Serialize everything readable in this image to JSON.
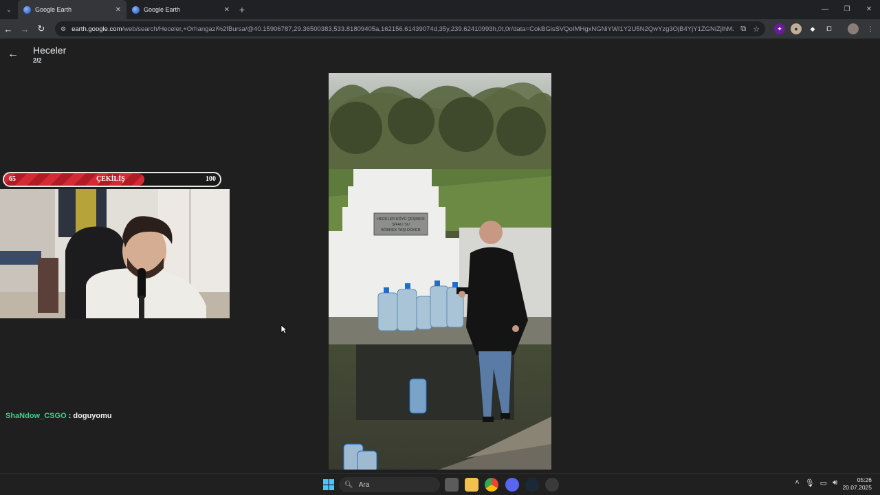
{
  "browser": {
    "tabs": [
      {
        "title": "Google Earth",
        "active": true
      },
      {
        "title": "Google Earth",
        "active": false
      }
    ],
    "url_host": "earth.google.com",
    "url_path": "/web/search/Heceler,+Orhangazi%2fBursa/@40.15906787,29.36500383,533.81809405a,162156.61439074d,35y,239.62410993h,0t,0r/data=CokBGisSVQoIMHgxNGNiYWI1Y2U5N2QwYzg3OjB4YjY1ZGNiZjlhMzlyMDljY..."
  },
  "earth": {
    "title": "Heceler",
    "counter": "2/2",
    "sign_text": "HECELER KÖYÜ ÇEŞMESİ ŞİFALI SU BÖBREK TAŞI DÖKER"
  },
  "overlay": {
    "giveaway_start": "65",
    "giveaway_label": "ÇEKİLİŞ",
    "giveaway_end": "100",
    "giveaway_progress": 0.65,
    "chat_user": "ShaNdow_CSGO",
    "chat_sep": " : ",
    "chat_message": "doguyomu"
  },
  "taskbar": {
    "search_placeholder": "Ara",
    "time": "05:26",
    "date": "20.07.2025"
  },
  "colors": {
    "chat_user": "#3fcf8e",
    "giveaway_fill": "#d42a34",
    "background": "#1f1f1f"
  }
}
